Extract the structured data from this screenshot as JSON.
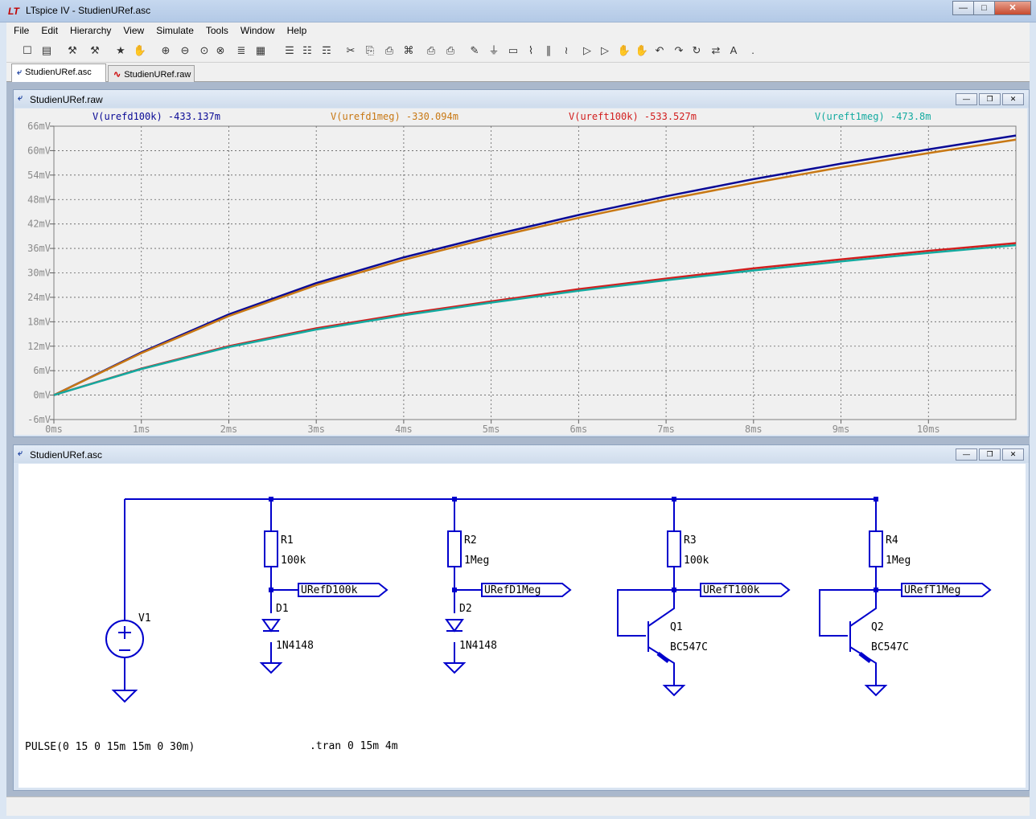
{
  "window": {
    "title": "LTspice IV - StudienURef.asc",
    "logo": "LT"
  },
  "menu": [
    "File",
    "Edit",
    "Hierarchy",
    "View",
    "Simulate",
    "Tools",
    "Window",
    "Help"
  ],
  "toolbar_icons": [
    "new-schematic-icon",
    "open-folder-icon",
    "control-panel-icon",
    "hammer-icon",
    "run-icon",
    "pan-hand-icon",
    "zoom-in-icon",
    "zoom-out-icon",
    "zoom-fit-icon",
    "zoom-cancel-icon",
    "autorange-icon",
    "grid-icon",
    "tile-horizontal-icon",
    "cascade-icon",
    "tile-vertical-icon",
    "cut-icon",
    "copy-icon",
    "paste-icon",
    "find-icon",
    "print-preview-icon",
    "print-icon",
    "wire-icon",
    "ground-icon",
    "label-net-icon",
    "resistor-icon",
    "capacitor-icon",
    "inductor-icon",
    "diode-icon",
    "component-icon",
    "move-icon",
    "drag-icon",
    "undo-icon",
    "redo-icon",
    "rotate-icon",
    "mirror-icon",
    "text-icon",
    "spice-directive-icon"
  ],
  "tabs": [
    {
      "label": "StudienURef.asc",
      "active": true
    },
    {
      "label": "StudienURef.raw",
      "active": false
    }
  ],
  "plot_window": {
    "title": "StudienURef.raw"
  },
  "schematic_window": {
    "title": "StudienURef.asc"
  },
  "chart_data": {
    "type": "line",
    "legend_placement": "top",
    "grid": true,
    "xlim": [
      0,
      11
    ],
    "ylim": [
      -6,
      66
    ],
    "x_ticks": [
      "0ms",
      "1ms",
      "2ms",
      "3ms",
      "4ms",
      "5ms",
      "6ms",
      "7ms",
      "8ms",
      "9ms",
      "10ms"
    ],
    "y_ticks": [
      "66mV",
      "60mV",
      "54mV",
      "48mV",
      "42mV",
      "36mV",
      "30mV",
      "24mV",
      "18mV",
      "12mV",
      "6mV",
      "0mV",
      "-6mV"
    ],
    "x": [
      0,
      1,
      2,
      3,
      4,
      5,
      6,
      7,
      8,
      9,
      10,
      11
    ],
    "series": [
      {
        "name": "V(urefd100k)",
        "cursor_value": "-433.137m",
        "color": "#0a0a96",
        "values": [
          0,
          10.5,
          19.8,
          27.5,
          33.8,
          39.2,
          44.2,
          48.8,
          53.0,
          56.8,
          60.3,
          63.7
        ]
      },
      {
        "name": "V(urefd1meg)",
        "cursor_value": "-330.094m",
        "color": "#c87814",
        "values": [
          0,
          10.3,
          19.4,
          27.0,
          33.2,
          38.6,
          43.5,
          48.0,
          52.1,
          55.9,
          59.4,
          62.7
        ]
      },
      {
        "name": "V(ureft100k)",
        "cursor_value": "-533.527m",
        "color": "#d21e1e",
        "values": [
          0,
          6.5,
          12.0,
          16.4,
          19.9,
          23.0,
          26.0,
          28.6,
          31.1,
          33.3,
          35.4,
          37.3
        ]
      },
      {
        "name": "V(ureft1meg)",
        "cursor_value": "-473.8m",
        "color": "#14aaa0",
        "values": [
          0,
          6.4,
          11.8,
          16.1,
          19.6,
          22.7,
          25.6,
          28.2,
          30.6,
          32.8,
          34.9,
          36.8
        ]
      }
    ]
  },
  "schematic": {
    "V1": {
      "name": "V1"
    },
    "R1": {
      "name": "R1",
      "value": "100k"
    },
    "R2": {
      "name": "R2",
      "value": "1Meg"
    },
    "R3": {
      "name": "R3",
      "value": "100k"
    },
    "R4": {
      "name": "R4",
      "value": "1Meg"
    },
    "D1": {
      "name": "D1",
      "value": "1N4148"
    },
    "D2": {
      "name": "D2",
      "value": "1N4148"
    },
    "Q1": {
      "name": "Q1",
      "value": "BC547C"
    },
    "Q2": {
      "name": "Q2",
      "value": "BC547C"
    },
    "labels": [
      "URefD100k",
      "URefD1Meg",
      "URefT100k",
      "URefT1Meg"
    ],
    "source_directive": "PULSE(0 15 0 15m 15m 0 30m)",
    "tran_directive": ".tran 0 15m 4m"
  }
}
